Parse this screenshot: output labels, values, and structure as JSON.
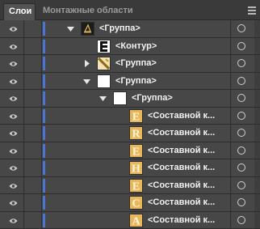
{
  "tabs": [
    {
      "label": "Слои"
    },
    {
      "label": "Монтажные области"
    }
  ],
  "layers": [
    {
      "label": "<Группа>",
      "depth": 0,
      "twisty": "expanded",
      "thumb": "group-icon"
    },
    {
      "label": "<Контур>",
      "depth": 1,
      "twisty": "none",
      "thumb": "e-path"
    },
    {
      "label": "<Группа>",
      "depth": 1,
      "twisty": "collapsed",
      "thumb": "group-pattern"
    },
    {
      "label": "<Группа>",
      "depth": 1,
      "twisty": "expanded",
      "thumb": "blank"
    },
    {
      "label": "<Группа>",
      "depth": 2,
      "twisty": "expanded",
      "thumb": "blank"
    },
    {
      "label": "<Составной к...",
      "depth": 3,
      "twisty": "none",
      "thumb": "letter-E"
    },
    {
      "label": "<Составной к...",
      "depth": 3,
      "twisty": "none",
      "thumb": "letter-R"
    },
    {
      "label": "<Составной к...",
      "depth": 3,
      "twisty": "none",
      "thumb": "letter-E"
    },
    {
      "label": "<Составной к...",
      "depth": 3,
      "twisty": "none",
      "thumb": "letter-H"
    },
    {
      "label": "<Составной к...",
      "depth": 3,
      "twisty": "none",
      "thumb": "letter-E"
    },
    {
      "label": "<Составной к...",
      "depth": 3,
      "twisty": "none",
      "thumb": "letter-C"
    },
    {
      "label": "<Составной к...",
      "depth": 3,
      "twisty": "none",
      "thumb": "letter-A"
    }
  ],
  "colors": {
    "panel_bg": "#535353",
    "row_bg": "#474747",
    "layer_color": "#4a74d6",
    "gold": "#d9a441"
  }
}
